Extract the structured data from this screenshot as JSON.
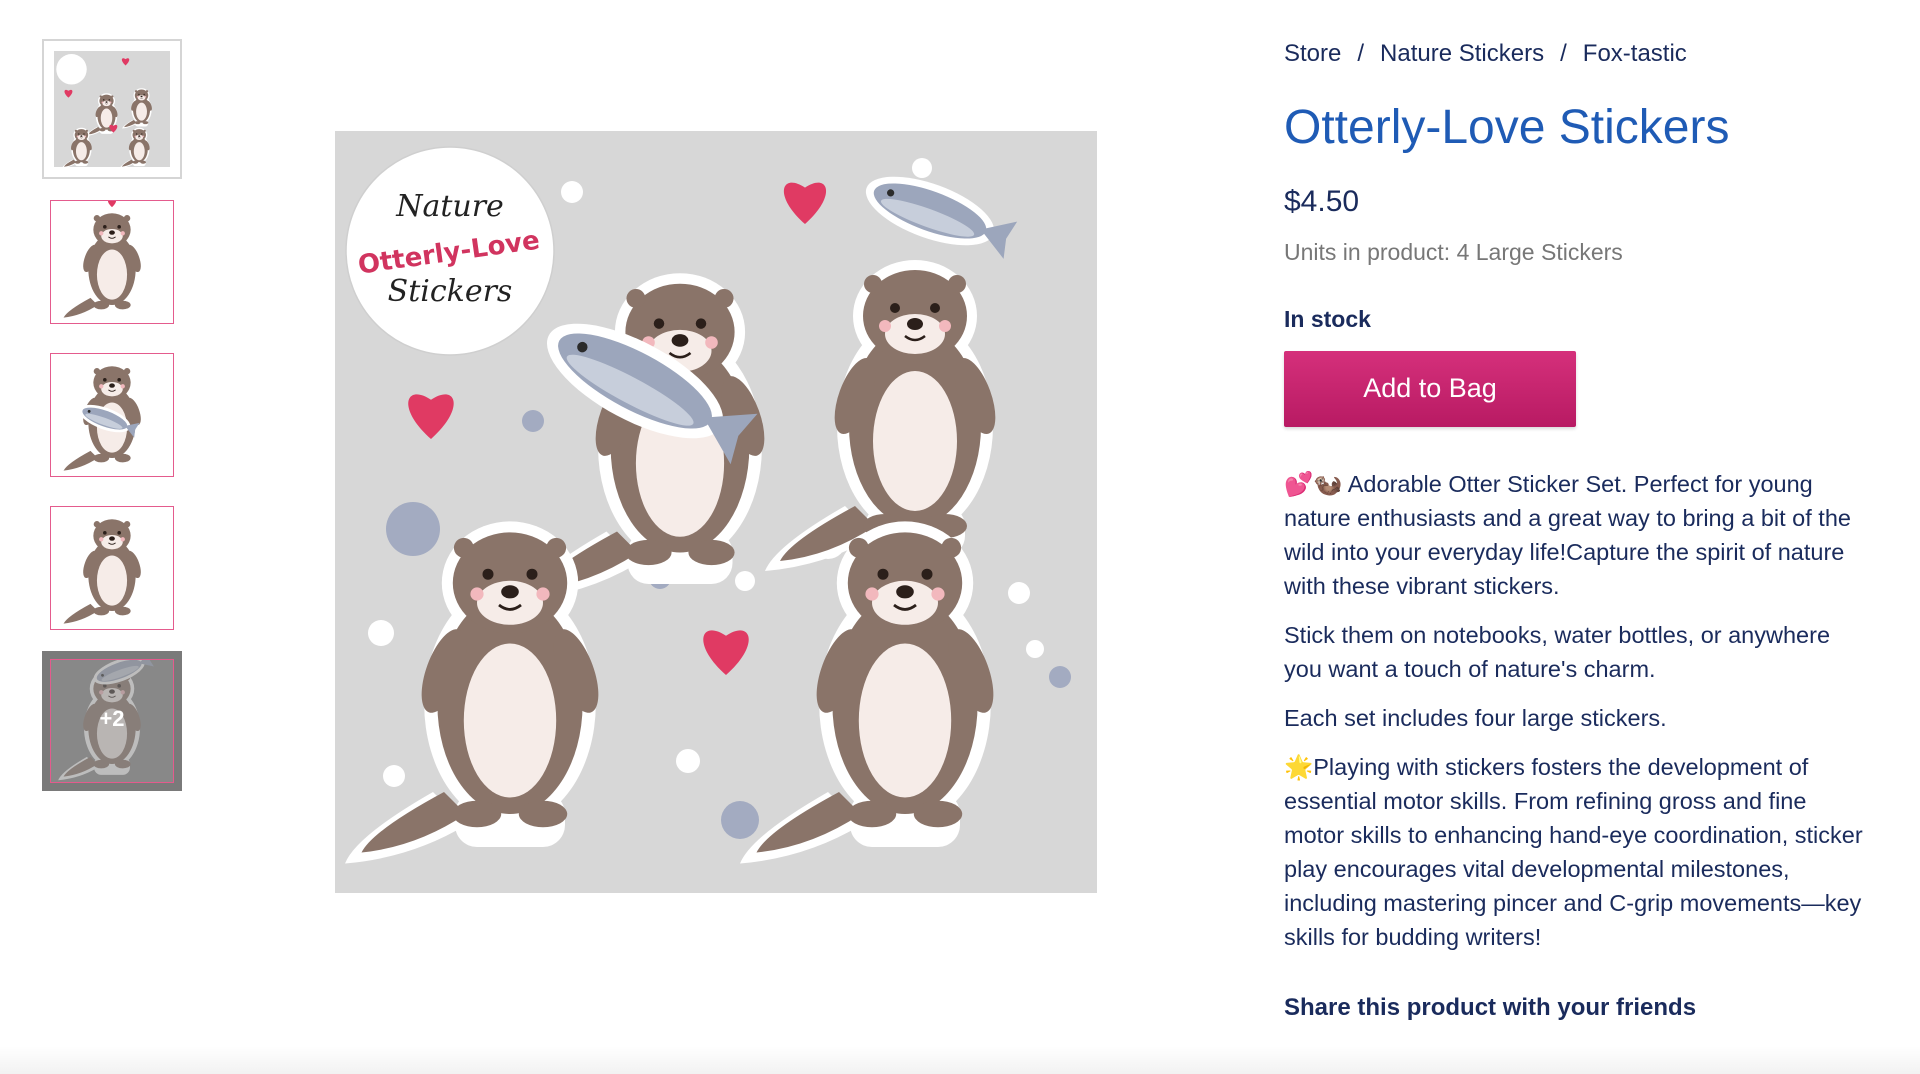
{
  "thumbnails": {
    "more_label": "+2"
  },
  "main_image": {
    "badge_line1": "Nature",
    "badge_line2": "Otterly-Love",
    "badge_line3": "Stickers"
  },
  "breadcrumb": {
    "store": "Store",
    "category": "Nature Stickers",
    "current": "Fox-tastic",
    "separator": "/"
  },
  "product": {
    "title": "Otterly-Love Stickers",
    "price": "$4.50",
    "units": "Units in product: 4 Large Stickers",
    "stock": "In stock",
    "add_to_bag": "Add to Bag"
  },
  "description": {
    "p1": "💕🦦 Adorable Otter Sticker Set. Perfect for young nature enthusiasts and a great way to bring a bit of the wild into your everyday life!Capture the spirit of nature with these vibrant stickers.",
    "p2": "Stick them on notebooks, water bottles, or anywhere you want a touch of nature's charm.",
    "p3": "Each set includes four large stickers.",
    "p4": "🌟Playing with stickers fosters the development of essential motor skills. From refining gross and fine motor skills to enhancing hand-eye coordination, sticker play encourages vital developmental milestones, including mastering pincer and C-grip movements—key skills for budding writers!"
  },
  "share": {
    "heading": "Share this product with your friends"
  },
  "colors": {
    "brand_pink": "#c8226d",
    "title_blue": "#1f5bb5",
    "text_navy": "#1a2b5c",
    "otter_brown": "#8a7469",
    "heart_red": "#e03a63"
  }
}
